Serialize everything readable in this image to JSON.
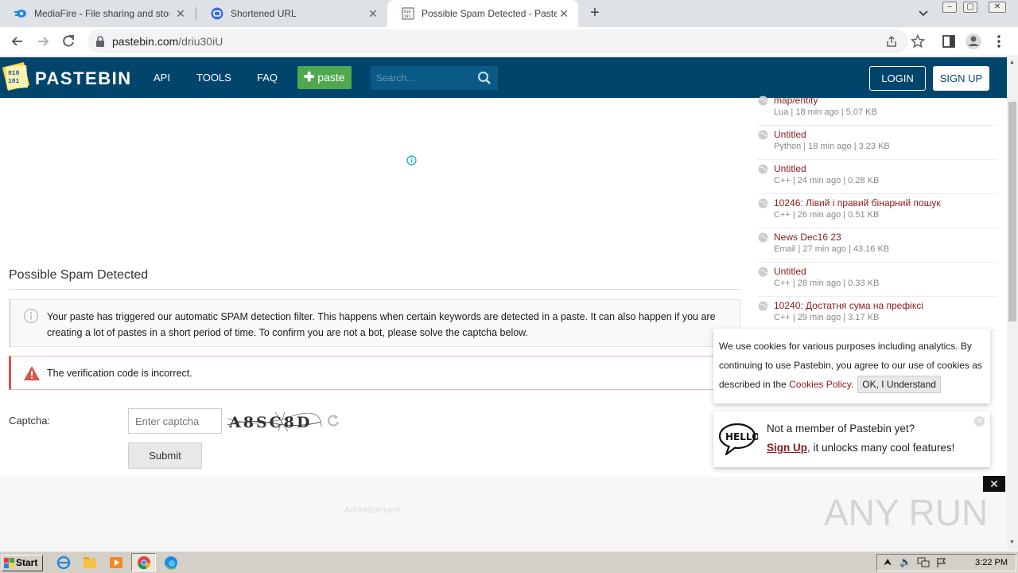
{
  "browser": {
    "tabs": [
      {
        "title": "MediaFire - File sharing and storage",
        "close": "✕"
      },
      {
        "title": "Shortened URL",
        "close": "✕"
      },
      {
        "title": "Possible Spam Detected - Pastebin.c",
        "close": "✕"
      }
    ],
    "new_tab": "+",
    "url_host": "pastebin.com",
    "url_path": "/driu30iU"
  },
  "header": {
    "logo_text": "PASTEBIN",
    "nav": [
      "API",
      "TOOLS",
      "FAQ"
    ],
    "paste_button": "paste",
    "search_placeholder": "Search...",
    "login": "LOGIN",
    "signup": "SIGN UP"
  },
  "main": {
    "title": "Possible Spam Detected",
    "notice": "Your paste has triggered our automatic SPAM detection filter. This happens when certain keywords are detected in a paste. It can also happen if you are creating a lot of pastes in a short period of time. To confirm you are not a bot, please solve the captcha below.",
    "error": "The verification code is incorrect.",
    "captcha_label": "Captcha:",
    "captcha_placeholder": "Enter captcha",
    "captcha_image_text": "A8SC8D",
    "submit": "Submit",
    "advertisement": "Advertisement"
  },
  "sidebar": {
    "items": [
      {
        "title": "map/entity",
        "meta": "Lua | 18 min ago | 5.07 KB"
      },
      {
        "title": "Untitled",
        "meta": "Python | 18 min ago | 3.23 KB"
      },
      {
        "title": "Untitled",
        "meta": "C++ | 24 min ago | 0.28 KB"
      },
      {
        "title": "10246: Лівий і правий бінарний пошук",
        "meta": "C++ | 26 min ago | 0.51 KB"
      },
      {
        "title": "News Dec16 23",
        "meta": "Email | 27 min ago | 43.16 KB"
      },
      {
        "title": "Untitled",
        "meta": "C++ | 28 min ago | 0.33 KB"
      },
      {
        "title": "10240: Достатня сума на префіксі",
        "meta": "C++ | 29 min ago | 3.17 KB"
      }
    ]
  },
  "cookie": {
    "text": "We use cookies for various purposes including analytics. By continuing to use Pastebin, you agree to our use of cookies as described in the",
    "link": "Cookies Policy",
    "period": ".",
    "ok": "OK, I Understand"
  },
  "hello": {
    "line1": "Not a member of Pastebin yet?",
    "signup_link": "Sign Up",
    "line2_rest": ", it unlocks many cool features!"
  },
  "taskbar": {
    "start": "Start",
    "clock": "3:22 PM"
  },
  "watermark": "ANY RUN",
  "colors": {
    "header": "#02456c",
    "paste_green": "#4fa84e",
    "link_red": "#8b1a1a",
    "error_red": "#d9534f"
  }
}
